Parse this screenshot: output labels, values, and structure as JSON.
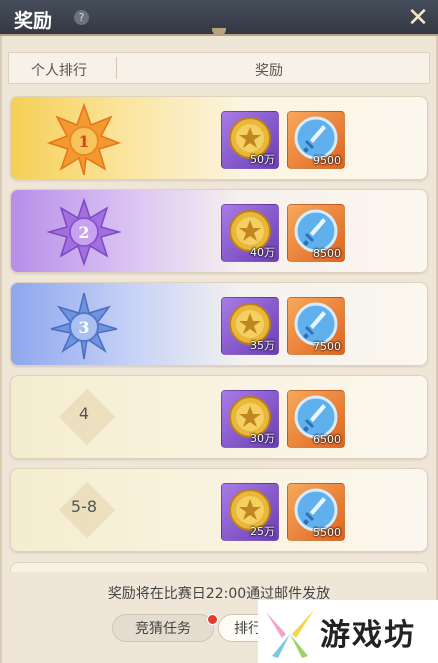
{
  "window": {
    "title": "奖励",
    "help_icon": "question-icon",
    "help_glyph": "?",
    "close_icon": "close-icon",
    "close_glyph": "✕"
  },
  "table_header": {
    "col_rank": "个人排行",
    "col_reward": "奖励"
  },
  "rows": [
    {
      "rank": "1",
      "medal": "gold",
      "coin_qty": "50万",
      "sword_qty": "9500"
    },
    {
      "rank": "2",
      "medal": "purple",
      "coin_qty": "40万",
      "sword_qty": "8500"
    },
    {
      "rank": "3",
      "medal": "blue",
      "coin_qty": "35万",
      "sword_qty": "7500"
    },
    {
      "rank": "4",
      "medal": "none",
      "coin_qty": "30万",
      "sword_qty": "6500"
    },
    {
      "rank": "5-8",
      "medal": "none",
      "coin_qty": "25万",
      "sword_qty": "5500"
    }
  ],
  "footer": {
    "notice": "奖励将在比赛日22:00通过邮件发放",
    "tab_quiz": "竞猜任务",
    "tab_rank": "排行"
  },
  "watermark": {
    "text": "游戏坊"
  },
  "colors": {
    "gold": "#f0a23a",
    "purple": "#9d6ad8",
    "blue": "#5f86d8",
    "badge_red": "#e43a2f"
  }
}
